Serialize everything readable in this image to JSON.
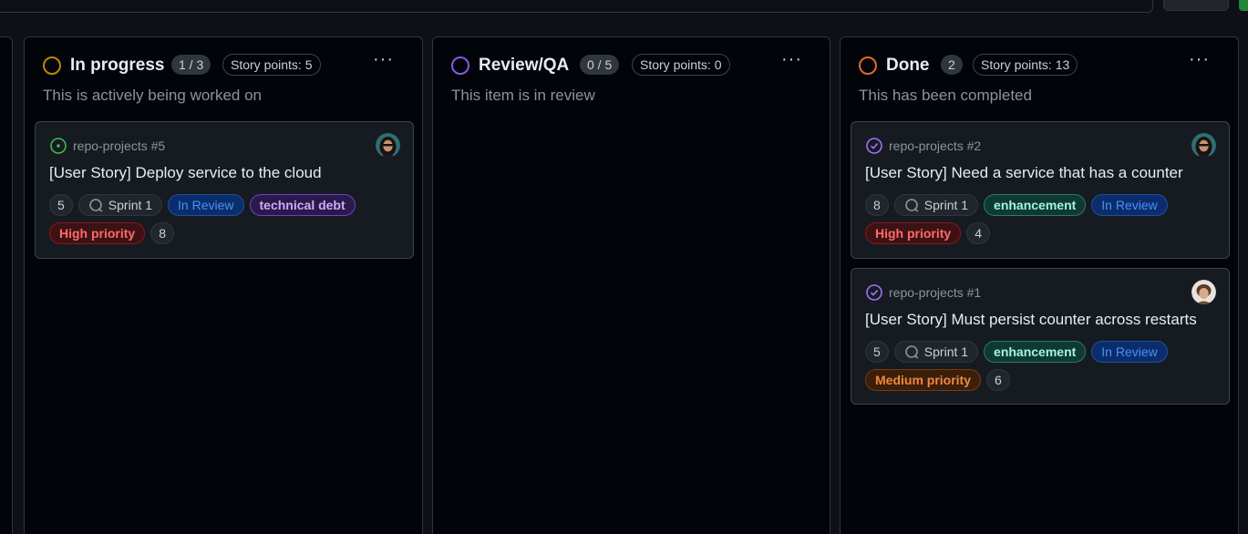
{
  "board": {
    "columns": [
      {
        "title": "In progress",
        "status_color": "#bf8700",
        "count": "1 / 3",
        "story_points": "Story points: 5",
        "description": "This is actively being worked on",
        "cards": [
          {
            "ref": "repo-projects #5",
            "state": "open",
            "title": "[User Story] Deploy service to the cloud",
            "tags": [
              {
                "label": "5",
                "kind": "num"
              },
              {
                "label": "Sprint 1",
                "kind": "sprint"
              },
              {
                "label": "In Review",
                "kind": "review"
              },
              {
                "label": "technical debt",
                "kind": "debt"
              }
            ],
            "tags2": [
              {
                "label": "High priority",
                "kind": "high"
              },
              {
                "label": "8",
                "kind": "num"
              }
            ]
          }
        ]
      },
      {
        "title": "Review/QA",
        "status_color": "#8957e5",
        "count": "0 / 5",
        "story_points": "Story points: 0",
        "description": "This item is in review",
        "cards": []
      },
      {
        "title": "Done",
        "status_color": "#db6d28",
        "count": "2",
        "story_points": "Story points: 13",
        "description": "This has been completed",
        "cards": [
          {
            "ref": "repo-projects #2",
            "state": "closed",
            "title": "[User Story] Need a service that has a counter",
            "tags": [
              {
                "label": "8",
                "kind": "num"
              },
              {
                "label": "Sprint 1",
                "kind": "sprint"
              },
              {
                "label": "enhancement",
                "kind": "enh"
              },
              {
                "label": "In Review",
                "kind": "review"
              }
            ],
            "tags2": [
              {
                "label": "High priority",
                "kind": "high"
              },
              {
                "label": "4",
                "kind": "num"
              }
            ]
          },
          {
            "ref": "repo-projects #1",
            "state": "closed",
            "title": "[User Story] Must persist counter across restarts",
            "tags": [
              {
                "label": "5",
                "kind": "num"
              },
              {
                "label": "Sprint 1",
                "kind": "sprint"
              },
              {
                "label": "enhancement",
                "kind": "enh"
              },
              {
                "label": "In Review",
                "kind": "review"
              }
            ],
            "tags2": [
              {
                "label": "Medium priority",
                "kind": "med"
              },
              {
                "label": "6",
                "kind": "num"
              }
            ]
          }
        ]
      }
    ],
    "more_label": "···"
  }
}
